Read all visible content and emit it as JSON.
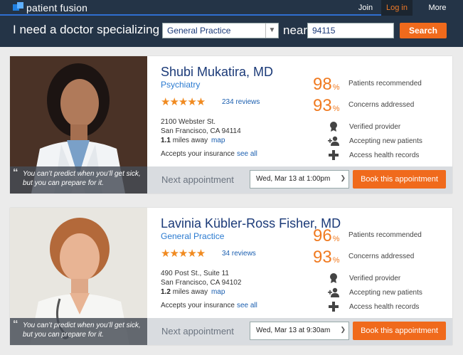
{
  "topbar": {
    "logo_text": "patient fusion",
    "nav": {
      "join": "Join",
      "login": "Log in",
      "more": "More"
    }
  },
  "search": {
    "prefix": "I need a doctor specializing in",
    "specialty": "General Practice",
    "near": "near",
    "zip": "94115",
    "button": "Search"
  },
  "doctors": [
    {
      "name": "Shubi Mukatira, MD",
      "specialty": "Psychiatry",
      "stars": "★★★★★",
      "reviews": "234 reviews",
      "address1": "2100 Webster St.",
      "address2": "San Francisco, CA 94114",
      "distance": "1.1",
      "distance_suffix": "miles away",
      "map": "map",
      "insurance": "Accepts your insurance",
      "see_all": "see all",
      "stat1_value": "98",
      "stat1_label": "Patients recommended",
      "stat2_value": "93",
      "stat2_label": "Concerns addressed",
      "features": [
        "Verified provider",
        "Accepting new patients",
        "Access health records"
      ],
      "quote": "You can’t predict when you’ll get sick, but you can prepare for it.",
      "next_label": "Next appointment",
      "appointment": "Wed, Mar 13 at 1:00pm",
      "book": "Book this appointment"
    },
    {
      "name": "Lavinia Kübler-Ross Fisher, MD",
      "specialty": "General Practice",
      "stars": "★★★★★",
      "reviews": "34 reviews",
      "address1": "490 Post St., Suite 11",
      "address2": "San Francisco, CA 94102",
      "distance": "1.2",
      "distance_suffix": "miles away",
      "map": "map",
      "insurance": "Accepts your insurance",
      "see_all": "see all",
      "stat1_value": "96",
      "stat1_label": "Patients recommended",
      "stat2_value": "93",
      "stat2_label": "Concerns addressed",
      "features": [
        "Verified provider",
        "Accepting new patients",
        "Access health records"
      ],
      "quote": "You can’t predict when you’ll get sick, but you can prepare for it.",
      "next_label": "Next appointment",
      "appointment": "Wed, Mar 13 at 9:30am",
      "book": "Book this appointment"
    }
  ],
  "colors": {
    "accent": "#f06a1c",
    "navy": "#243447",
    "link": "#1b5fb0",
    "heading": "#1b3a78"
  },
  "icons": [
    "logo-mark-icon",
    "chevron-down-icon",
    "quote-icon",
    "badge-icon",
    "add-person-icon",
    "medical-cross-icon"
  ]
}
